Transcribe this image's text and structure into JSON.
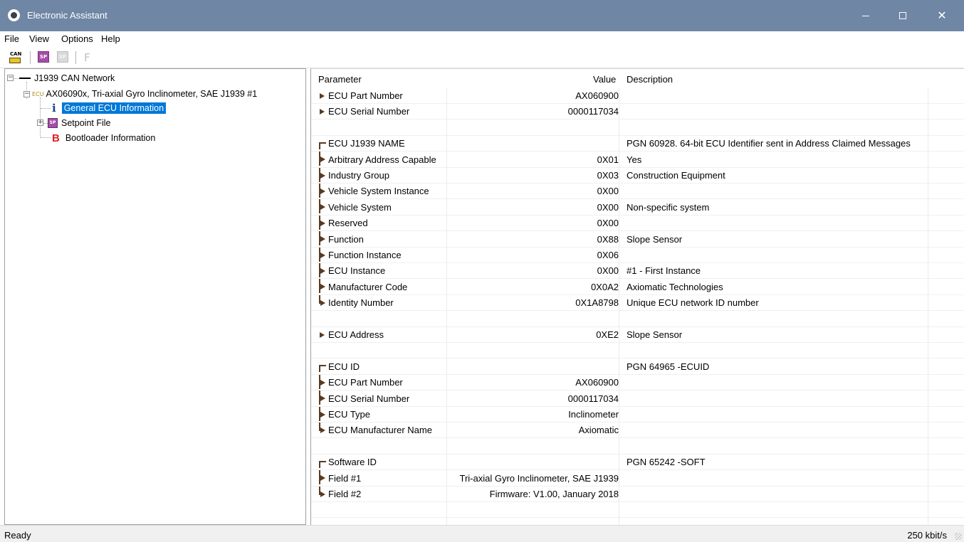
{
  "window": {
    "title": "Electronic Assistant",
    "controls": {
      "minimize": "—",
      "maximize": "☐",
      "close": "✕"
    }
  },
  "menu": [
    "File",
    "View",
    "Options",
    "Help"
  ],
  "toolbar": {
    "can_label": "CAN",
    "sp_label": "SP",
    "f_label": "F"
  },
  "tree": {
    "network": "J1939 CAN Network",
    "ecu_tag": "ECU",
    "ecu": "AX06090x, Tri-axial Gyro Inclinometer, SAE J1939 #1",
    "info_glyph": "i",
    "items": [
      "General ECU Information",
      "Setpoint File",
      "Bootloader Information"
    ],
    "sp_glyph": "SP",
    "boot_glyph": "B"
  },
  "list": {
    "columns": [
      "Parameter",
      "Value",
      "Description"
    ],
    "rows": [
      {
        "glyph": "bullet",
        "param": "ECU Part Number",
        "value": "AX060900",
        "desc": ""
      },
      {
        "glyph": "bullet",
        "param": "ECU Serial Number",
        "value": "0000117034",
        "desc": ""
      },
      {
        "glyph": "",
        "param": "",
        "value": "",
        "desc": ""
      },
      {
        "glyph": "start",
        "param": "ECU J1939 NAME",
        "value": "",
        "desc": "PGN 60928. 64-bit ECU Identifier sent in Address Claimed Messages"
      },
      {
        "glyph": "mid",
        "param": "Arbitrary Address Capable",
        "value": "0X01",
        "desc": "Yes"
      },
      {
        "glyph": "mid",
        "param": "Industry Group",
        "value": "0X03",
        "desc": "Construction Equipment"
      },
      {
        "glyph": "mid",
        "param": "Vehicle System Instance",
        "value": "0X00",
        "desc": ""
      },
      {
        "glyph": "mid",
        "param": "Vehicle System",
        "value": "0X00",
        "desc": "Non-specific system"
      },
      {
        "glyph": "mid",
        "param": "Reserved",
        "value": "0X00",
        "desc": ""
      },
      {
        "glyph": "mid",
        "param": "Function",
        "value": "0X88",
        "desc": "Slope Sensor"
      },
      {
        "glyph": "mid",
        "param": "Function Instance",
        "value": "0X06",
        "desc": ""
      },
      {
        "glyph": "mid",
        "param": "ECU Instance",
        "value": "0X00",
        "desc": "#1 - First Instance"
      },
      {
        "glyph": "mid",
        "param": "Manufacturer Code",
        "value": "0X0A2",
        "desc": "Axiomatic Technologies"
      },
      {
        "glyph": "end",
        "param": "Identity Number",
        "value": "0X1A8798",
        "desc": "Unique ECU network ID number"
      },
      {
        "glyph": "",
        "param": "",
        "value": "",
        "desc": ""
      },
      {
        "glyph": "bullet",
        "param": "ECU Address",
        "value": "0XE2",
        "desc": "Slope Sensor"
      },
      {
        "glyph": "",
        "param": "",
        "value": "",
        "desc": ""
      },
      {
        "glyph": "start",
        "param": "ECU ID",
        "value": "",
        "desc": "PGN 64965   -ECUID"
      },
      {
        "glyph": "mid",
        "param": "ECU Part Number",
        "value": "AX060900",
        "desc": ""
      },
      {
        "glyph": "mid",
        "param": "ECU Serial Number",
        "value": "0000117034",
        "desc": ""
      },
      {
        "glyph": "mid",
        "param": "ECU Type",
        "value": "Inclinometer",
        "desc": ""
      },
      {
        "glyph": "end",
        "param": "ECU Manufacturer Name",
        "value": "Axiomatic",
        "desc": ""
      },
      {
        "glyph": "",
        "param": "",
        "value": "",
        "desc": ""
      },
      {
        "glyph": "start",
        "param": "Software ID",
        "value": "",
        "desc": "PGN 65242   -SOFT"
      },
      {
        "glyph": "mid",
        "param": "Field #1",
        "value": "Tri-axial Gyro Inclinometer, SAE J1939",
        "desc": ""
      },
      {
        "glyph": "end",
        "param": "Field #2",
        "value": "Firmware: V1.00, January 2018",
        "desc": ""
      },
      {
        "glyph": "",
        "param": "",
        "value": "",
        "desc": ""
      }
    ]
  },
  "status": {
    "left": "Ready",
    "right": "250 kbit/s"
  }
}
